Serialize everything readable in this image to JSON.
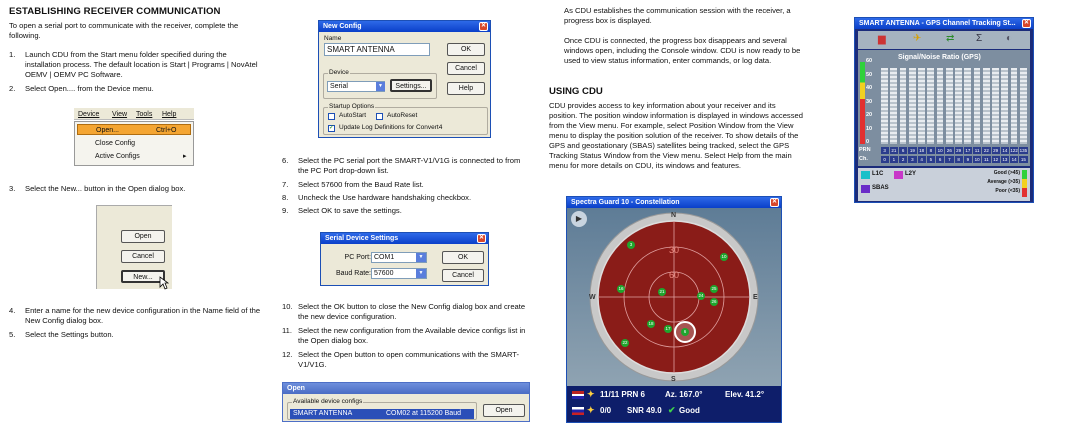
{
  "col1": {
    "title": "ESTABLISHING RECEIVER COMMUNICATION",
    "intro": "To open a serial port to communicate with the receiver, complete the following.",
    "steps": [
      {
        "n": "1.",
        "t": "Launch CDU from the Start menu folder specified during the installation process. The default location is Start | Programs | NovAtel OEMV | OEMV PC Software."
      },
      {
        "n": "2.",
        "t": "Select Open.... from the Device menu."
      },
      {
        "n": "3.",
        "t": "Select the New... button in the Open dialog box."
      },
      {
        "n": "4.",
        "t": "Enter a name for the new device configuration in the Name field of the New Config dialog box."
      },
      {
        "n": "5.",
        "t": "Select the Settings button."
      }
    ],
    "menu": {
      "bar": [
        "Device",
        "View",
        "Tools",
        "Help"
      ],
      "items": [
        {
          "label": "Open...",
          "shortcut": "Ctrl+O"
        },
        {
          "label": "Close Config",
          "shortcut": ""
        },
        {
          "label": "Active Configs",
          "shortcut": "▸"
        }
      ]
    },
    "open_dialog": {
      "buttons": [
        "Open",
        "Cancel",
        "New..."
      ]
    }
  },
  "col2": {
    "new_config": {
      "title": "New Config",
      "name_label": "Name",
      "name_value": "SMART ANTENNA",
      "ok": "OK",
      "cancel": "Cancel",
      "help": "Help",
      "device_label": "Device",
      "device_value": "Serial",
      "settings": "Settings...",
      "startup_label": "Startup Options",
      "auto_start": "AutoStart",
      "auto_reset": "AutoReset",
      "update_log": "Update Log Definitions for Convert4"
    },
    "steps": [
      {
        "n": "6.",
        "t": "Select the PC serial port the SMART-V1/V1G is connected to from the PC Port drop-down list."
      },
      {
        "n": "7.",
        "t": "Select 57600 from the Baud Rate list."
      },
      {
        "n": "8.",
        "t": "Uncheck the Use hardware handshaking checkbox."
      },
      {
        "n": "9.",
        "t": "Select OK to save the settings."
      },
      {
        "n": "10.",
        "t": "Select the OK button to close the New Config dialog box and create the new device configuration."
      },
      {
        "n": "11.",
        "t": "Select the new configuration from the Available device configs list in the Open dialog box."
      },
      {
        "n": "12.",
        "t": "Select the Open button to open communications with the SMART-V1/V1G."
      }
    ],
    "serial": {
      "title": "Serial Device Settings",
      "pc_port_label": "PC Port:",
      "pc_port": "COM1",
      "baud_label": "Baud Rate:",
      "baud": "57600",
      "ok": "OK",
      "cancel": "Cancel"
    },
    "open2": {
      "title": "Open",
      "group": "Available device configs",
      "item_name": "SMART ANTENNA",
      "item_port": "COM02 at 115200 Baud",
      "open": "Open"
    }
  },
  "col3": {
    "p1": "As CDU establishes the communication session with the receiver, a progress box is displayed.",
    "p2": "Once CDU is connected, the progress box disappears and several windows open, including the Console window. CDU is now ready to be used to view status information, enter commands, or log data.",
    "h2": "USING CDU",
    "p3": "CDU provides access to key information about your receiver and its position. The position window information is displayed in windows accessed from the View menu. For example, select Position Window from the View menu to display the position solution of the receiver. To show details of the GPS and geostationary (SBAS) satellites being tracked, select the GPS Tracking Status Window from the View menu. Select Help from the main menu for more details on CDU, its windows and features.",
    "constellation": {
      "title": "Spectra Guard 10 - Constellation",
      "ring_labels": [
        "30",
        "60"
      ],
      "compass": [
        "N",
        "E",
        "S",
        "W"
      ],
      "sats": [
        "3",
        "10",
        "16",
        "21",
        "24",
        "25",
        "26",
        "18",
        "17",
        "22",
        "6"
      ],
      "status1": "11/11 PRN 6",
      "az": "Az. 167.0°",
      "elev": "Elev. 41.2°",
      "status2": "0/0",
      "snr": "SNR 49.0",
      "good": "Good"
    }
  },
  "col4": {
    "tracking": {
      "title": "SMART ANTENNA - GPS Channel Tracking St...",
      "chart_title": "Signal/Noise Ratio (GPS)",
      "y_ticks": [
        "60",
        "50",
        "40",
        "30",
        "20",
        "10",
        "0"
      ],
      "prn_label": "PRN",
      "ch_label": "Ch.",
      "prns": [
        "3",
        "21",
        "6",
        "19",
        "18",
        "8",
        "10",
        "26",
        "29",
        "17",
        "11",
        "22",
        "29",
        "14",
        "122",
        "135"
      ],
      "chs": [
        "0",
        "1",
        "2",
        "3",
        "4",
        "5",
        "6",
        "7",
        "8",
        "9",
        "10",
        "11",
        "12",
        "13",
        "14",
        "15"
      ],
      "legend": [
        "L1C",
        "L2Y",
        "SBAS"
      ],
      "quality": [
        "Good (>45)",
        "Average (>35)",
        "Poor (<35)"
      ]
    }
  }
}
